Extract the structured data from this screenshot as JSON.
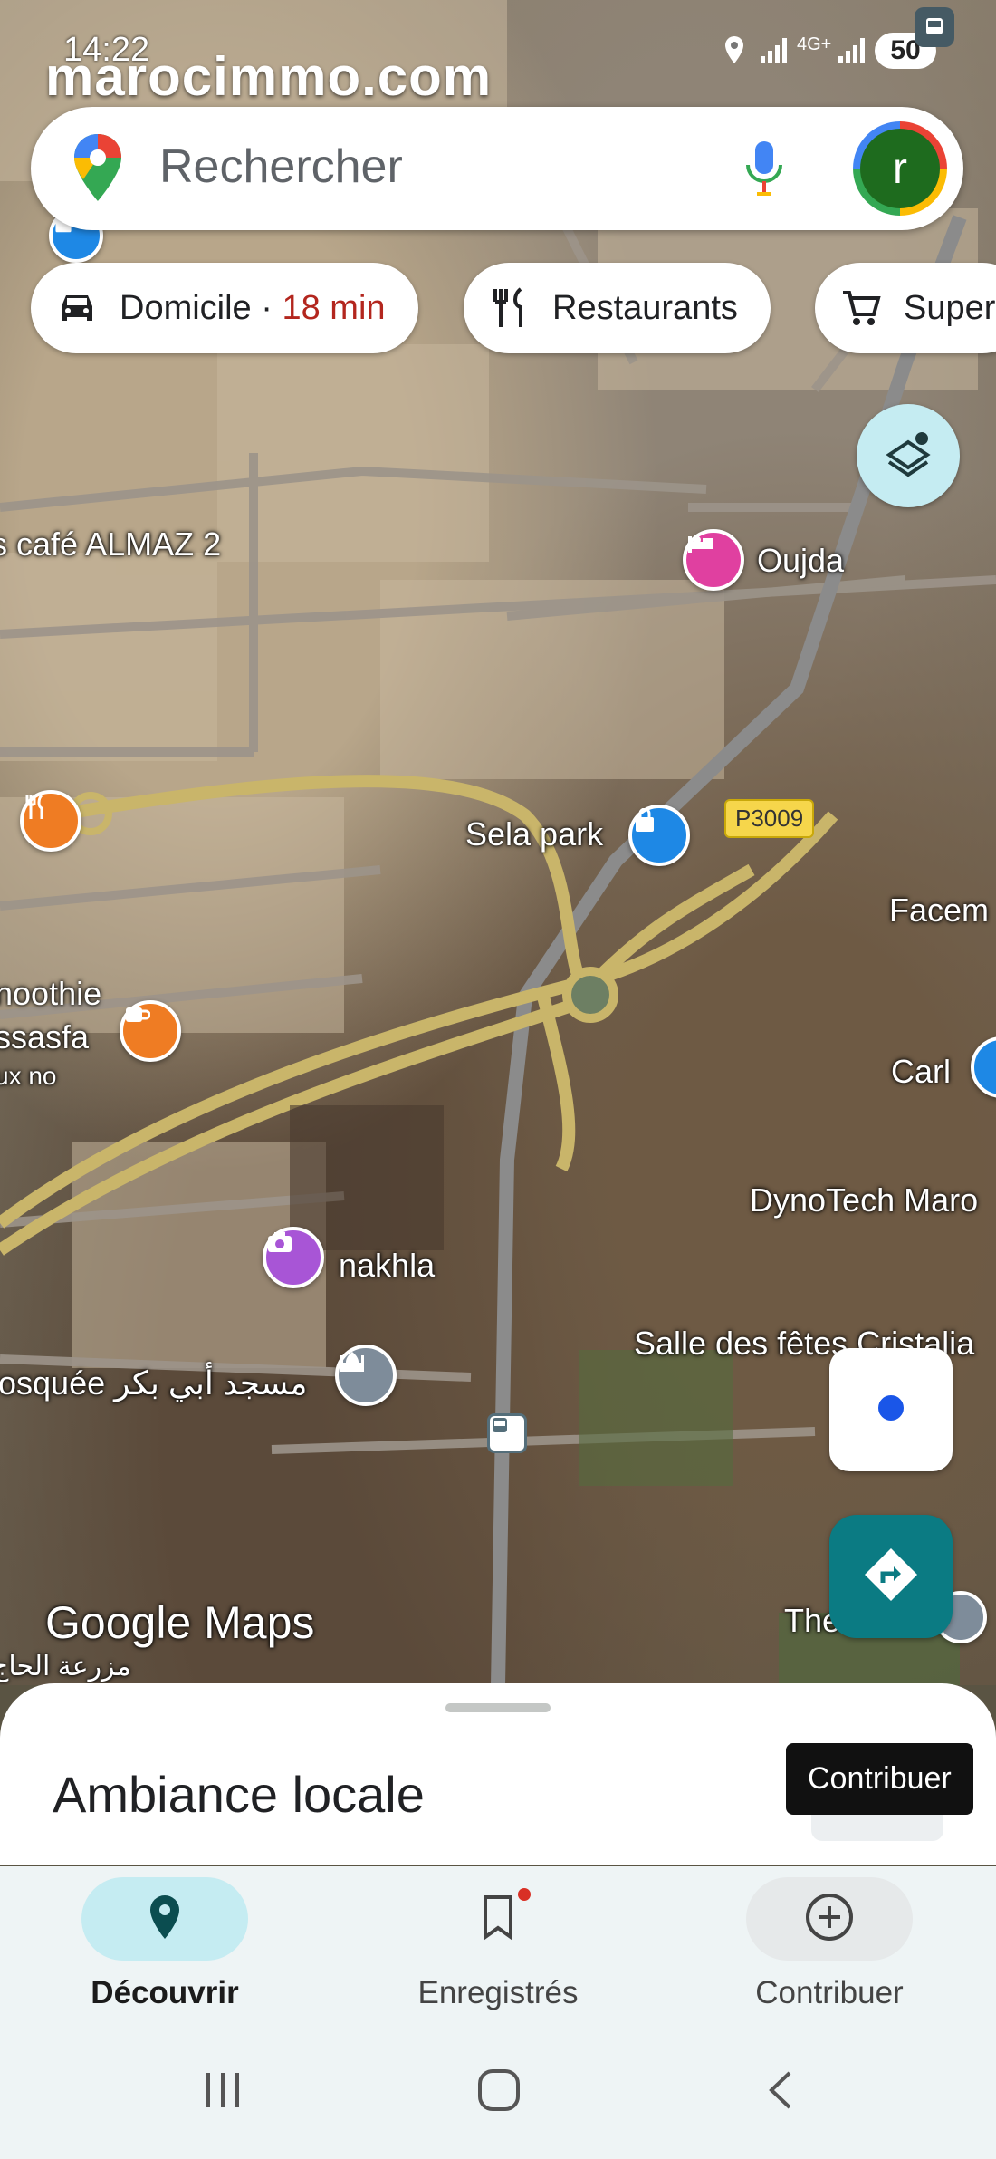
{
  "status_bar": {
    "time": "14:22",
    "battery": "50",
    "network": "4G+"
  },
  "watermark": "marocimmo.com",
  "search": {
    "placeholder": "Rechercher",
    "avatar_letter": "r"
  },
  "chips": [
    {
      "label": "Domicile",
      "separator": " · ",
      "duration": "18 min",
      "icon": "car-icon"
    },
    {
      "label": "Restaurants",
      "icon": "fork-knife-icon"
    },
    {
      "label": "Super",
      "icon": "cart-icon"
    }
  ],
  "map": {
    "labels": {
      "cafe": "s café ALMAZ 2",
      "oujda": "Oujda",
      "sela_park": "Sela park",
      "road_badge": "P3009",
      "facem": "Facem",
      "smoothie": "noothie",
      "ssasfa": "ssasfa",
      "uxno": "ux no",
      "carl": "Carl",
      "dynotech": "DynoTech Maro",
      "nakhla": "nakhla",
      "salle": "Salle des fêtes Cristalia",
      "mosque": "losquée مسجد أبي بكر",
      "the": "The",
      "farm": "مزرعة الحاج"
    },
    "logo": "Google Maps"
  },
  "sheet": {
    "title": "Ambiance locale",
    "tooltip": "Contribuer"
  },
  "nav": [
    {
      "label": "Découvrir",
      "icon": "location-pin-icon",
      "active": true
    },
    {
      "label": "Enregistrés",
      "icon": "bookmark-icon",
      "active": false,
      "badge": true
    },
    {
      "label": "Contribuer",
      "icon": "add-circle-icon",
      "active": false
    }
  ],
  "colors": {
    "accent_teal": "#0b7b83",
    "duration_red": "#b3261e",
    "active_pill": "#c5ecf2"
  }
}
